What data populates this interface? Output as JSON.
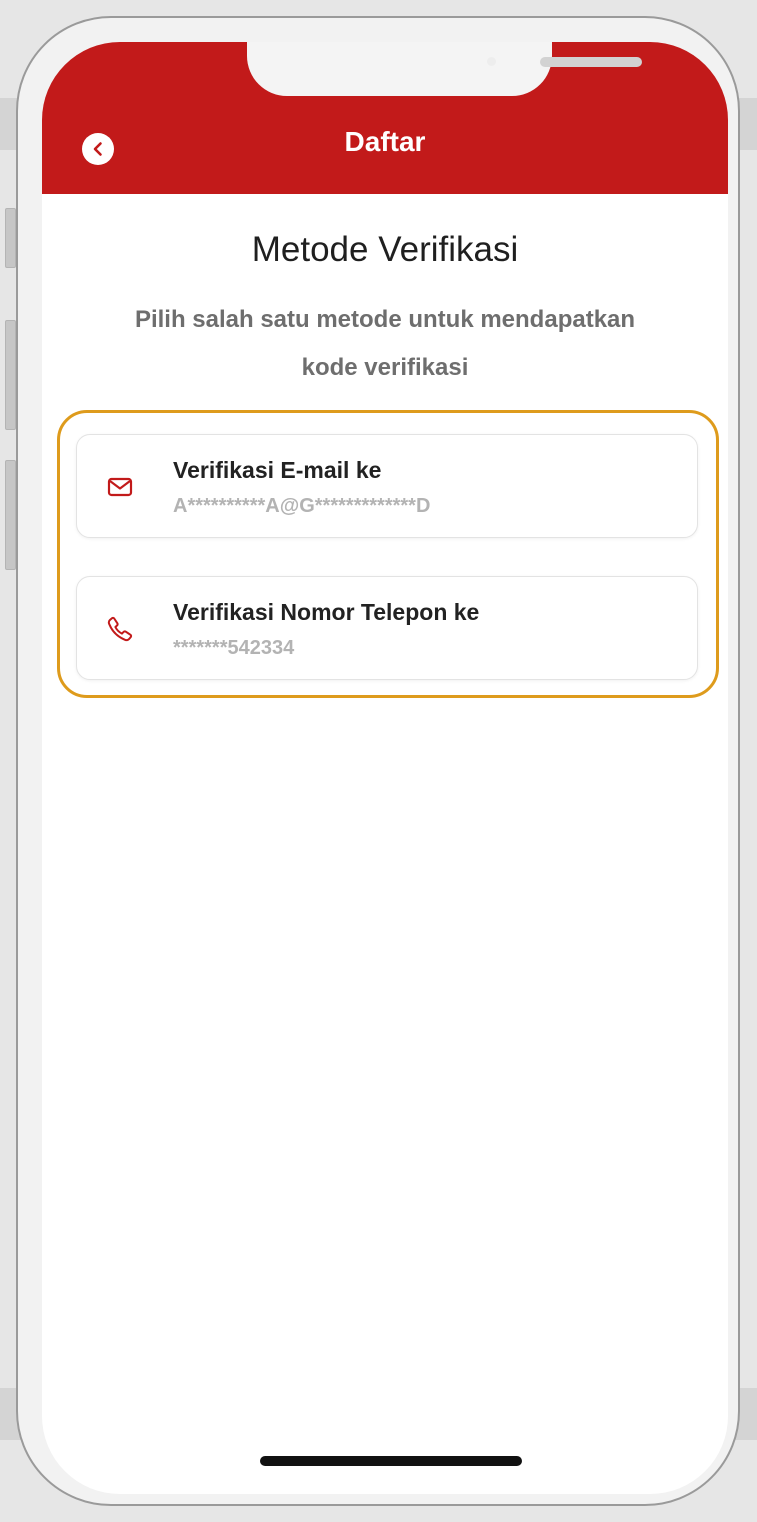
{
  "header": {
    "title": "Daftar"
  },
  "main": {
    "title": "Metode Verifikasi",
    "subtitle_line1": "Pilih salah satu metode untuk mendapatkan",
    "subtitle_line2": "kode verifikasi"
  },
  "options": [
    {
      "title": "Verifikasi E-mail ke",
      "value": "A**********A@G*************D",
      "icon": "mail-icon"
    },
    {
      "title": "Verifikasi Nomor Telepon ke",
      "value": "*******542334",
      "icon": "phone-icon"
    }
  ],
  "colors": {
    "brand_red": "#c21a1a",
    "highlight": "#de9b1c",
    "icon_red": "#c21a1a"
  },
  "icons": {
    "back": "chevron-left-icon"
  }
}
